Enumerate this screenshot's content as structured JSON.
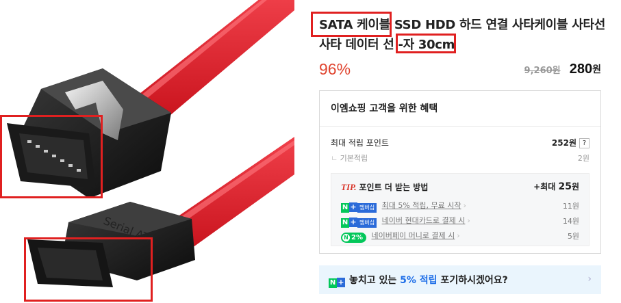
{
  "product": {
    "title_line1": "SATA 케이블 SSD HDD 하드 연결 사타케이블 사타선",
    "title_line2": "사타 데이터 선 -자 30cm",
    "image_text": "Serial ATA"
  },
  "price": {
    "discount": "96%",
    "original": "9,260원",
    "sale": "280",
    "sale_unit": "원"
  },
  "benefits": {
    "heading": "이엠쇼핑 고객을 위한 혜택",
    "max_points_label": "최대 적립 포인트",
    "max_points_value": "252원",
    "help_badge": "?",
    "basic_label": "기본적립",
    "basic_value": "2원",
    "tip": {
      "logo": "TIP.",
      "heading": "포인트 더 받는 방법",
      "max_prefix": "+최대",
      "max_value": "25",
      "max_unit": "원",
      "items": [
        {
          "badge": "멤버십",
          "text": "최대 5% 적립, 무료 시작",
          "amount": "11원"
        },
        {
          "badge": "멤버십",
          "text": "네이버 현대카드로 결제 시",
          "amount": "14원"
        },
        {
          "badge": "2%",
          "text": "네이버페이 머니로 결제 시",
          "amount": "5원"
        }
      ]
    }
  },
  "banner": {
    "pre": "놓치고 있는 ",
    "highlight": "5% 적립",
    "post": " 포기하시겠어요?"
  },
  "colors": {
    "discount_red": "#e0442f",
    "naver_green": "#03c75a",
    "naver_blue": "#2b6bd9",
    "annotation_red": "#e02020",
    "cable_red": "#e8232c",
    "banner_bg": "#eaf5fd"
  },
  "icons": {
    "chevron": "›",
    "naver_n": "N",
    "naver_plus": "+"
  }
}
